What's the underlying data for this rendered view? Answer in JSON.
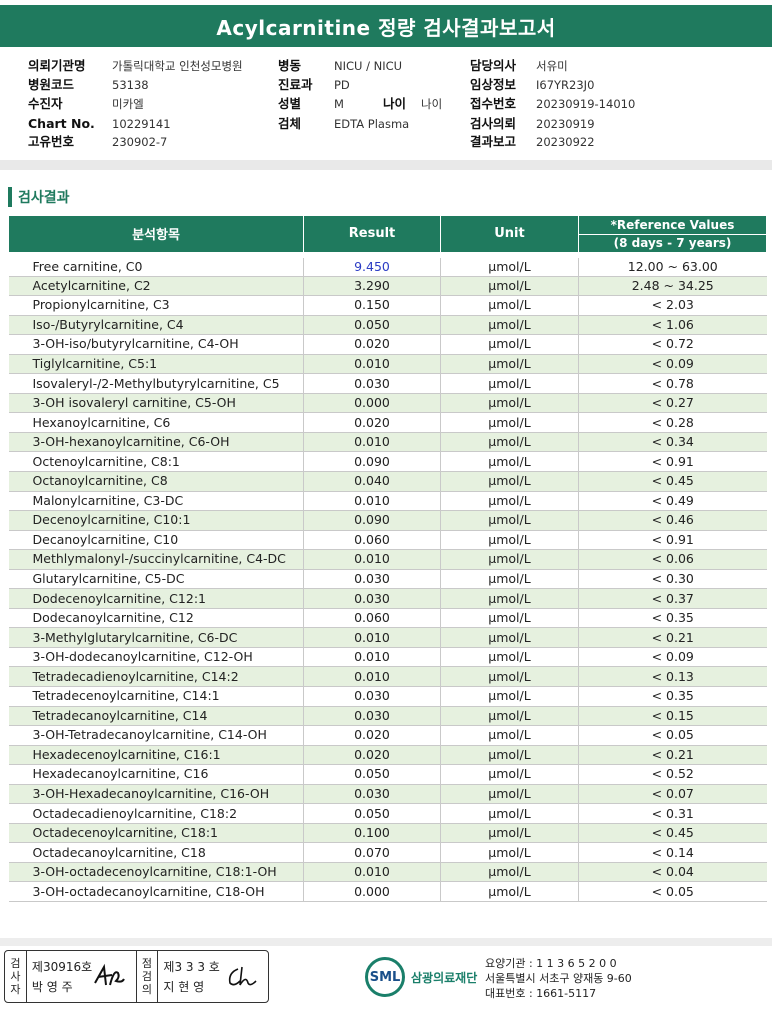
{
  "report": {
    "title": "Acylcarnitine 정량 검사결과보고서"
  },
  "patient": {
    "col1": [
      {
        "label": "의뢰기관명",
        "value": "가톨릭대학교 인천성모병원"
      },
      {
        "label": "병원코드",
        "value": "53138"
      },
      {
        "label": "수진자",
        "value": "미카엘"
      },
      {
        "label": "Chart No.",
        "value": "10229141"
      },
      {
        "label": "고유번호",
        "value": "230902-7"
      }
    ],
    "col2": [
      {
        "label": "병동",
        "value": "NICU / NICU"
      },
      {
        "label": "진료과",
        "value": "PD"
      },
      {
        "label": "성별",
        "value": "M"
      },
      {
        "label": "검체",
        "value": "EDTA Plasma"
      }
    ],
    "age_label": "나이",
    "age_value": "나이",
    "col3": [
      {
        "label": "담당의사",
        "value": "서유미"
      },
      {
        "label": "임상정보",
        "value": "I67YR23J0"
      },
      {
        "label": "접수번호",
        "value": "20230919-14010"
      },
      {
        "label": "검사의뢰",
        "value": "20230919"
      },
      {
        "label": "결과보고",
        "value": "20230922"
      }
    ]
  },
  "results": {
    "section_title": "검사결과",
    "headers": {
      "item": "분석항목",
      "result": "Result",
      "unit": "Unit",
      "ref_title": "*Reference Values",
      "ref_range": "(8 days - 7 years)"
    },
    "rows": [
      {
        "name": "Free carnitine, C0",
        "result": "9.450",
        "unit": "μmol/L",
        "ref": "12.00 ~ 63.00"
      },
      {
        "name": "Acetylcarnitine, C2",
        "result": "3.290",
        "unit": "μmol/L",
        "ref": "2.48 ~ 34.25"
      },
      {
        "name": "Propionylcarnitine, C3",
        "result": "0.150",
        "unit": "μmol/L",
        "ref": "< 2.03"
      },
      {
        "name": "Iso-/Butyrylcarnitine, C4",
        "result": "0.050",
        "unit": "μmol/L",
        "ref": "< 1.06"
      },
      {
        "name": "3-OH-iso/butyrylcarnitine, C4-OH",
        "result": "0.020",
        "unit": "μmol/L",
        "ref": "< 0.72"
      },
      {
        "name": "Tiglylcarnitine, C5:1",
        "result": "0.010",
        "unit": "μmol/L",
        "ref": "< 0.09"
      },
      {
        "name": "Isovaleryl-/2-Methylbutyrylcarnitine, C5",
        "result": "0.030",
        "unit": "μmol/L",
        "ref": "< 0.78"
      },
      {
        "name": "3-OH isovaleryl carnitine, C5-OH",
        "result": "0.000",
        "unit": "μmol/L",
        "ref": "< 0.27"
      },
      {
        "name": "Hexanoylcarnitine, C6",
        "result": "0.020",
        "unit": "μmol/L",
        "ref": "< 0.28"
      },
      {
        "name": "3-OH-hexanoylcarnitine, C6-OH",
        "result": "0.010",
        "unit": "μmol/L",
        "ref": "< 0.34"
      },
      {
        "name": "Octenoylcarnitine, C8:1",
        "result": "0.090",
        "unit": "μmol/L",
        "ref": "< 0.91"
      },
      {
        "name": "Octanoylcarnitine, C8",
        "result": "0.040",
        "unit": "μmol/L",
        "ref": "< 0.45"
      },
      {
        "name": "Malonylcarnitine, C3-DC",
        "result": "0.010",
        "unit": "μmol/L",
        "ref": "< 0.49"
      },
      {
        "name": "Decenoylcarnitine, C10:1",
        "result": "0.090",
        "unit": "μmol/L",
        "ref": "< 0.46"
      },
      {
        "name": "Decanoylcarnitine, C10",
        "result": "0.060",
        "unit": "μmol/L",
        "ref": "< 0.91"
      },
      {
        "name": "Methlymalonyl-/succinylcarnitine, C4-DC",
        "result": "0.010",
        "unit": "μmol/L",
        "ref": "< 0.06"
      },
      {
        "name": "Glutarylcarnitine, C5-DC",
        "result": "0.030",
        "unit": "μmol/L",
        "ref": "< 0.30"
      },
      {
        "name": "Dodecenoylcarnitine, C12:1",
        "result": "0.030",
        "unit": "μmol/L",
        "ref": "< 0.37"
      },
      {
        "name": "Dodecanoylcarnitine, C12",
        "result": "0.060",
        "unit": "μmol/L",
        "ref": "< 0.35"
      },
      {
        "name": "3-Methylglutarylcarnitine, C6-DC",
        "result": "0.010",
        "unit": "μmol/L",
        "ref": "< 0.21"
      },
      {
        "name": "3-OH-dodecanoylcarnitine, C12-OH",
        "result": "0.010",
        "unit": "μmol/L",
        "ref": "< 0.09"
      },
      {
        "name": "Tetradecadienoylcarnitine, C14:2",
        "result": "0.010",
        "unit": "μmol/L",
        "ref": "< 0.13"
      },
      {
        "name": "Tetradecenoylcarnitine, C14:1",
        "result": "0.030",
        "unit": "μmol/L",
        "ref": "< 0.35"
      },
      {
        "name": "Tetradecanoylcarnitine, C14",
        "result": "0.030",
        "unit": "μmol/L",
        "ref": "< 0.15"
      },
      {
        "name": "3-OH-Tetradecanoylcarnitine, C14-OH",
        "result": "0.020",
        "unit": "μmol/L",
        "ref": "< 0.05"
      },
      {
        "name": "Hexadecenoylcarnitine, C16:1",
        "result": "0.020",
        "unit": "μmol/L",
        "ref": "< 0.21"
      },
      {
        "name": "Hexadecanoylcarnitine, C16",
        "result": "0.050",
        "unit": "μmol/L",
        "ref": "< 0.52"
      },
      {
        "name": "3-OH-Hexadecanoylcarnitine, C16-OH",
        "result": "0.030",
        "unit": "μmol/L",
        "ref": "< 0.07"
      },
      {
        "name": "Octadecadienoylcarnitine, C18:2",
        "result": "0.050",
        "unit": "μmol/L",
        "ref": "< 0.31"
      },
      {
        "name": "Octadecenoylcarnitine, C18:1",
        "result": "0.100",
        "unit": "μmol/L",
        "ref": "< 0.45"
      },
      {
        "name": "Octadecanoylcarnitine, C18",
        "result": "0.070",
        "unit": "μmol/L",
        "ref": "< 0.14"
      },
      {
        "name": "3-OH-octadecenoylcarnitine, C18:1-OH",
        "result": "0.010",
        "unit": "μmol/L",
        "ref": "< 0.04"
      },
      {
        "name": "3-OH-octadecanoylcarnitine, C18-OH",
        "result": "0.000",
        "unit": "μmol/L",
        "ref": "< 0.05"
      }
    ]
  },
  "signatures": {
    "examiner_label": "검사자",
    "examiner_no": "제30916호",
    "examiner_name": "박 영 주",
    "reviewer_label": "점검의",
    "reviewer_no": "제3 3 3 호",
    "reviewer_name": "지 현 영"
  },
  "org": {
    "logo_mark": "SML",
    "logo_name": "삼광의료재단",
    "code_line": "요양기관 : 1 1 3 6 5 2 0 0",
    "address_line": "서울특별시 서초구 양재동 9-60",
    "phone_line": "대표번호 : 1661-5117"
  }
}
